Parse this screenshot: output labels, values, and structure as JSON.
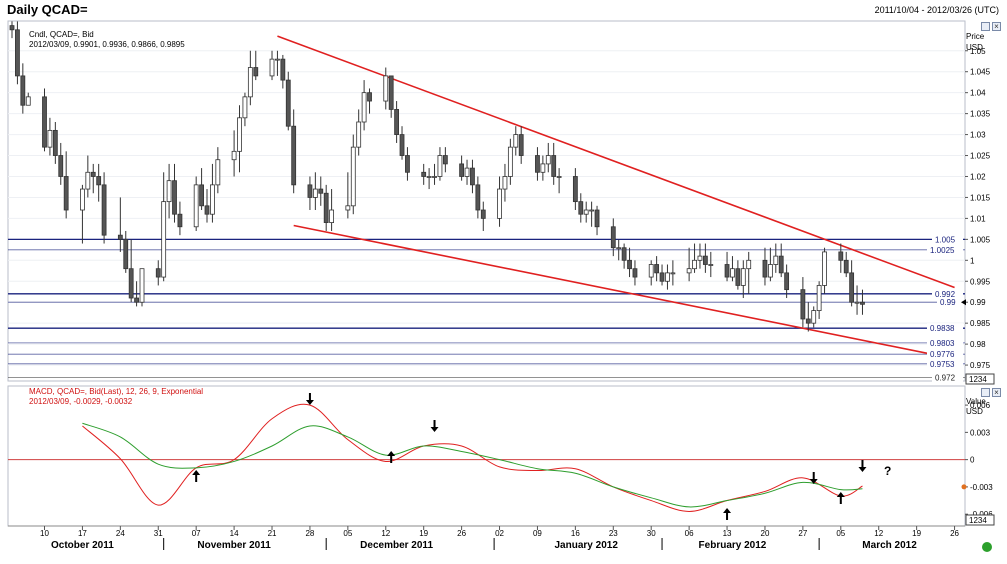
{
  "header": {
    "title": "Daily QCAD=",
    "range": "2011/10/04 - 2012/03/26 (UTC)"
  },
  "price_panel": {
    "legend_line1": "Cndl, QCAD=, Bid",
    "legend_line2": "2012/03/09, 0.9901, 0.9936, 0.9866, 0.9895",
    "axis_title": "Price",
    "axis_unit": "USD",
    "bottom_box": "1234"
  },
  "macd_panel": {
    "legend_line1": "MACD, QCAD=, Bid(Last), 12, 26, 9, Exponential",
    "legend_line2": "2012/03/09, -0.0029, -0.0032",
    "axis_title": "Value",
    "axis_unit": "USD",
    "bottom_box": "1234",
    "question_mark": "?"
  },
  "colors": {
    "up": "#ffffff",
    "down": "#555555",
    "trend": "#e02020",
    "level": "#1a237e",
    "macd": "#e02020",
    "signal": "#2e9e2e",
    "zero": "#d04040"
  },
  "chart_data": [
    {
      "type": "candlestick",
      "title": "Daily QCAD=",
      "ylabel": "Price USD",
      "ylim": [
        0.9712,
        1.0571
      ],
      "yticks": [
        "1.05",
        "1.045",
        "1.04",
        "1.035",
        "1.03",
        "1.025",
        "1.02",
        "1.015",
        "1.01",
        "1.005",
        "1",
        "0.995",
        "0.99",
        "0.985",
        "0.98",
        "0.975"
      ],
      "current_price_label": "0.99",
      "x": [
        "2011-10-04",
        "2011-10-05",
        "2011-10-06",
        "2011-10-07",
        "2011-10-10",
        "2011-10-11",
        "2011-10-12",
        "2011-10-13",
        "2011-10-14",
        "2011-10-17",
        "2011-10-18",
        "2011-10-19",
        "2011-10-20",
        "2011-10-21",
        "2011-10-24",
        "2011-10-25",
        "2011-10-26",
        "2011-10-27",
        "2011-10-28",
        "2011-10-31",
        "2011-11-01",
        "2011-11-02",
        "2011-11-03",
        "2011-11-04",
        "2011-11-07",
        "2011-11-08",
        "2011-11-09",
        "2011-11-10",
        "2011-11-11",
        "2011-11-14",
        "2011-11-15",
        "2011-11-16",
        "2011-11-17",
        "2011-11-18",
        "2011-11-21",
        "2011-11-22",
        "2011-11-23",
        "2011-11-24",
        "2011-11-25",
        "2011-11-28",
        "2011-11-29",
        "2011-11-30",
        "2011-12-01",
        "2011-12-02",
        "2011-12-05",
        "2011-12-06",
        "2011-12-07",
        "2011-12-08",
        "2011-12-09",
        "2011-12-12",
        "2011-12-13",
        "2011-12-14",
        "2011-12-15",
        "2011-12-16",
        "2011-12-19",
        "2011-12-20",
        "2011-12-21",
        "2011-12-22",
        "2011-12-23",
        "2011-12-26",
        "2011-12-27",
        "2011-12-28",
        "2011-12-29",
        "2011-12-30",
        "2012-01-02",
        "2012-01-03",
        "2012-01-04",
        "2012-01-05",
        "2012-01-06",
        "2012-01-09",
        "2012-01-10",
        "2012-01-11",
        "2012-01-12",
        "2012-01-13",
        "2012-01-16",
        "2012-01-17",
        "2012-01-18",
        "2012-01-19",
        "2012-01-20",
        "2012-01-23",
        "2012-01-24",
        "2012-01-25",
        "2012-01-26",
        "2012-01-27",
        "2012-01-30",
        "2012-01-31",
        "2012-02-01",
        "2012-02-02",
        "2012-02-03",
        "2012-02-06",
        "2012-02-07",
        "2012-02-08",
        "2012-02-09",
        "2012-02-10",
        "2012-02-13",
        "2012-02-14",
        "2012-02-15",
        "2012-02-16",
        "2012-02-17",
        "2012-02-20",
        "2012-02-21",
        "2012-02-22",
        "2012-02-23",
        "2012-02-24",
        "2012-02-27",
        "2012-02-28",
        "2012-02-29",
        "2012-03-01",
        "2012-03-02",
        "2012-03-05",
        "2012-03-06",
        "2012-03-07",
        "2012-03-08",
        "2012-03-09"
      ],
      "open": [
        1.056,
        1.055,
        1.044,
        1.037,
        1.039,
        1.027,
        1.031,
        1.025,
        1.02,
        1.012,
        1.017,
        1.021,
        1.02,
        1.018,
        1.006,
        1.005,
        0.998,
        0.991,
        0.99,
        0.998,
        0.996,
        1.014,
        1.019,
        1.011,
        1.008,
        1.018,
        1.013,
        1.011,
        1.018,
        1.024,
        1.026,
        1.034,
        1.039,
        1.046,
        1.044,
        1.048,
        1.048,
        1.043,
        1.032,
        1.018,
        1.015,
        1.017,
        1.016,
        1.009,
        1.012,
        1.013,
        1.027,
        1.033,
        1.04,
        1.038,
        1.044,
        1.036,
        1.03,
        1.025,
        1.021,
        1.02,
        1.02,
        1.02,
        1.025,
        1.023,
        1.02,
        1.022,
        1.018,
        1.012,
        1.01,
        1.017,
        1.02,
        1.027,
        1.03,
        1.025,
        1.021,
        1.023,
        1.025,
        1.02,
        1.02,
        1.014,
        1.011,
        1.012,
        1.012,
        1.008,
        1.003,
        1.003,
        1.0,
        0.998,
        0.996,
        0.999,
        0.997,
        0.995,
        0.997,
        0.997,
        0.998,
        1.0,
        1.001,
        0.999,
        0.999,
        0.996,
        0.998,
        0.994,
        0.998,
        1.0,
        0.996,
        0.999,
        1.001,
        0.997,
        0.993,
        0.986,
        0.985,
        0.988,
        0.994,
        1.002,
        1.0,
        0.997,
        0.99,
        0.99
      ],
      "high": [
        1.057,
        1.057,
        1.047,
        1.04,
        1.041,
        1.034,
        1.033,
        1.028,
        1.026,
        1.018,
        1.025,
        1.023,
        1.023,
        1.021,
        1.015,
        1.007,
        1.005,
        0.995,
        0.998,
        1.0,
        1.021,
        1.023,
        1.023,
        1.014,
        1.02,
        1.022,
        1.017,
        1.023,
        1.027,
        1.031,
        1.037,
        1.04,
        1.05,
        1.05,
        1.05,
        1.05,
        1.049,
        1.045,
        1.036,
        1.02,
        1.021,
        1.02,
        1.018,
        1.017,
        1.021,
        1.03,
        1.036,
        1.043,
        1.041,
        1.046,
        1.044,
        1.038,
        1.032,
        1.027,
        1.023,
        1.022,
        1.023,
        1.027,
        1.027,
        1.025,
        1.024,
        1.024,
        1.02,
        1.014,
        1.02,
        1.023,
        1.029,
        1.032,
        1.032,
        1.027,
        1.025,
        1.028,
        1.028,
        1.022,
        1.022,
        1.016,
        1.014,
        1.014,
        1.013,
        1.01,
        1.005,
        1.004,
        1.003,
        1.0,
        1.0,
        1.001,
        0.999,
        0.999,
        1.0,
        1.003,
        1.004,
        1.004,
        1.004,
        1.002,
        1.002,
        1.001,
        1.0,
        1.0,
        1.002,
        1.003,
        1.003,
        1.004,
        1.004,
        0.999,
        0.996,
        0.99,
        0.989,
        0.995,
        1.003,
        1.004,
        1.002,
        1.0,
        0.994,
        0.993
      ],
      "low": [
        1.053,
        1.042,
        1.035,
        1.037,
        1.026,
        1.025,
        1.023,
        1.018,
        1.01,
        1.004,
        1.015,
        1.016,
        1.014,
        1.004,
        1.002,
        0.997,
        0.99,
        0.989,
        0.989,
        0.994,
        0.995,
        1.01,
        1.009,
        1.006,
        1.007,
        1.012,
        1.009,
        1.009,
        1.016,
        1.02,
        1.021,
        1.032,
        1.037,
        1.043,
        1.043,
        1.044,
        1.041,
        1.031,
        1.016,
        1.012,
        1.012,
        1.013,
        1.007,
        1.007,
        1.01,
        1.011,
        1.025,
        1.031,
        1.035,
        1.036,
        1.034,
        1.028,
        1.024,
        1.019,
        1.018,
        1.017,
        1.018,
        1.019,
        1.021,
        1.019,
        1.018,
        1.016,
        1.01,
        1.007,
        1.008,
        1.014,
        1.018,
        1.025,
        1.023,
        1.019,
        1.019,
        1.021,
        1.018,
        1.016,
        1.012,
        1.009,
        1.009,
        1.008,
        1.006,
        1.001,
        1.0,
        0.998,
        0.996,
        0.994,
        0.994,
        0.995,
        0.994,
        0.993,
        0.994,
        0.995,
        0.997,
        0.998,
        0.997,
        0.996,
        0.995,
        0.995,
        0.993,
        0.991,
        0.992,
        0.994,
        0.995,
        0.997,
        0.996,
        0.991,
        0.984,
        0.983,
        0.984,
        0.986,
        0.992,
        0.997,
        0.996,
        0.989,
        0.987,
        0.987
      ],
      "close": [
        1.055,
        1.044,
        1.037,
        1.039,
        1.027,
        1.031,
        1.025,
        1.02,
        1.012,
        1.017,
        1.021,
        1.02,
        1.018,
        1.006,
        1.005,
        0.998,
        0.991,
        0.99,
        0.998,
        0.996,
        1.014,
        1.019,
        1.011,
        1.008,
        1.018,
        1.013,
        1.011,
        1.018,
        1.024,
        1.026,
        1.034,
        1.039,
        1.046,
        1.044,
        1.048,
        1.048,
        1.043,
        1.032,
        1.018,
        1.015,
        1.017,
        1.016,
        1.009,
        1.012,
        1.013,
        1.027,
        1.033,
        1.04,
        1.038,
        1.044,
        1.036,
        1.03,
        1.025,
        1.021,
        1.02,
        1.02,
        1.02,
        1.025,
        1.023,
        1.02,
        1.022,
        1.018,
        1.012,
        1.01,
        1.017,
        1.02,
        1.027,
        1.03,
        1.025,
        1.021,
        1.023,
        1.025,
        1.02,
        1.02,
        1.014,
        1.011,
        1.012,
        1.012,
        1.008,
        1.003,
        1.003,
        1.0,
        0.998,
        0.996,
        0.999,
        0.997,
        0.995,
        0.997,
        0.997,
        0.998,
        1.0,
        1.001,
        0.999,
        0.999,
        0.996,
        0.998,
        0.994,
        0.998,
        1.0,
        0.996,
        0.999,
        1.001,
        0.997,
        0.993,
        0.986,
        0.985,
        0.988,
        0.994,
        1.002,
        1.0,
        0.997,
        0.99,
        0.99,
        0.9895
      ],
      "trendlines": [
        {
          "from": [
            "2011-11-22",
            1.0535
          ],
          "to": [
            "2012-03-26",
            0.9935
          ]
        },
        {
          "from": [
            "2011-11-25",
            1.0083
          ],
          "to": [
            "2012-03-26",
            0.9765
          ]
        }
      ],
      "horizontal_levels": [
        {
          "value": 1.005,
          "label": "1.005"
        },
        {
          "value": 1.0025,
          "label": "1.0025"
        },
        {
          "value": 0.992,
          "label": "0.992"
        },
        {
          "value": 0.99,
          "label": "0.99"
        },
        {
          "value": 0.9838,
          "label": "0.9838"
        },
        {
          "value": 0.9803,
          "label": "0.9803"
        },
        {
          "value": 0.9776,
          "label": "0.9776"
        },
        {
          "value": 0.9753,
          "label": "0.9753"
        },
        {
          "value": 0.972,
          "label": "0.972"
        }
      ]
    },
    {
      "type": "line",
      "title": "MACD, QCAD=, Bid(Last), 12, 26, 9, Exponential",
      "ylabel": "Value USD",
      "ylim": [
        -0.0073,
        0.0081
      ],
      "yticks": [
        "0.006",
        "0.003",
        "0",
        "-0.003",
        "-0.006"
      ],
      "current_value_label": "-0.003",
      "series": [
        {
          "name": "MACD",
          "anchors": [
            [
              "2011-10-17",
              0.0037
            ],
            [
              "2011-10-24",
              0.0001
            ],
            [
              "2011-10-31",
              -0.005
            ],
            [
              "2011-11-07",
              -0.0009
            ],
            [
              "2011-11-14",
              0.0
            ],
            [
              "2011-11-21",
              0.0045
            ],
            [
              "2011-11-28",
              0.006
            ],
            [
              "2011-12-05",
              0.0022
            ],
            [
              "2011-12-12",
              -0.0002
            ],
            [
              "2011-12-19",
              0.0015
            ],
            [
              "2011-12-26",
              0.0015
            ],
            [
              "2012-01-02",
              -0.0008
            ],
            [
              "2012-01-09",
              -0.0012
            ],
            [
              "2012-01-16",
              -0.001
            ],
            [
              "2012-01-23",
              -0.003
            ],
            [
              "2012-01-30",
              -0.0045
            ],
            [
              "2012-02-06",
              -0.0057
            ],
            [
              "2012-02-13",
              -0.0045
            ],
            [
              "2012-02-20",
              -0.0035
            ],
            [
              "2012-02-27",
              -0.002
            ],
            [
              "2012-03-05",
              -0.004
            ],
            [
              "2012-03-09",
              -0.0029
            ]
          ]
        },
        {
          "name": "Signal",
          "anchors": [
            [
              "2011-10-17",
              0.004
            ],
            [
              "2011-10-24",
              0.0025
            ],
            [
              "2011-10-31",
              -0.0005
            ],
            [
              "2011-11-07",
              -0.0009
            ],
            [
              "2011-11-14",
              -0.0002
            ],
            [
              "2011-11-21",
              0.0015
            ],
            [
              "2011-11-28",
              0.0037
            ],
            [
              "2011-12-05",
              0.0025
            ],
            [
              "2011-12-12",
              0.0005
            ],
            [
              "2011-12-19",
              0.0015
            ],
            [
              "2011-12-26",
              0.0009
            ],
            [
              "2012-01-02",
              0.0
            ],
            [
              "2012-01-09",
              -0.001
            ],
            [
              "2012-01-16",
              -0.0015
            ],
            [
              "2012-01-23",
              -0.003
            ],
            [
              "2012-01-30",
              -0.0042
            ],
            [
              "2012-02-06",
              -0.0052
            ],
            [
              "2012-02-13",
              -0.0045
            ],
            [
              "2012-02-20",
              -0.0037
            ],
            [
              "2012-02-27",
              -0.0025
            ],
            [
              "2012-03-05",
              -0.0033
            ],
            [
              "2012-03-09",
              -0.0032
            ]
          ]
        }
      ],
      "arrows": [
        {
          "date": "2011-11-07",
          "dir": "up"
        },
        {
          "date": "2011-11-28",
          "dir": "down"
        },
        {
          "date": "2011-12-13",
          "dir": "up"
        },
        {
          "date": "2011-12-21",
          "dir": "down"
        },
        {
          "date": "2012-02-13",
          "dir": "up"
        },
        {
          "date": "2012-02-29",
          "dir": "down"
        },
        {
          "date": "2012-03-05",
          "dir": "up"
        },
        {
          "date": "2012-03-09",
          "dir": "down"
        }
      ]
    }
  ],
  "x_axis": {
    "day_ticks": [
      [
        "2011-10-10",
        "10"
      ],
      [
        "2011-10-17",
        "17"
      ],
      [
        "2011-10-24",
        "24"
      ],
      [
        "2011-10-31",
        "31"
      ],
      [
        "2011-11-07",
        "07"
      ],
      [
        "2011-11-14",
        "14"
      ],
      [
        "2011-11-21",
        "21"
      ],
      [
        "2011-11-28",
        "28"
      ],
      [
        "2011-12-05",
        "05"
      ],
      [
        "2011-12-12",
        "12"
      ],
      [
        "2011-12-19",
        "19"
      ],
      [
        "2011-12-26",
        "26"
      ],
      [
        "2012-01-02",
        "02"
      ],
      [
        "2012-01-09",
        "09"
      ],
      [
        "2012-01-16",
        "16"
      ],
      [
        "2012-01-23",
        "23"
      ],
      [
        "2012-01-30",
        "30"
      ],
      [
        "2012-02-06",
        "06"
      ],
      [
        "2012-02-13",
        "13"
      ],
      [
        "2012-02-20",
        "20"
      ],
      [
        "2012-02-27",
        "27"
      ],
      [
        "2012-03-05",
        "05"
      ],
      [
        "2012-03-12",
        "12"
      ],
      [
        "2012-03-19",
        "19"
      ],
      [
        "2012-03-26",
        "26"
      ]
    ],
    "month_labels": [
      [
        "2011-10-17",
        "October 2011"
      ],
      [
        "2011-11-14",
        "November 2011"
      ],
      [
        "2011-12-14",
        "December 2011"
      ],
      [
        "2012-01-18",
        "January 2012"
      ],
      [
        "2012-02-14",
        "February 2012"
      ],
      [
        "2012-03-14",
        "March 2012"
      ]
    ],
    "month_separators": [
      "2011-11-01",
      "2011-12-01",
      "2012-01-01",
      "2012-02-01",
      "2012-03-01"
    ]
  }
}
